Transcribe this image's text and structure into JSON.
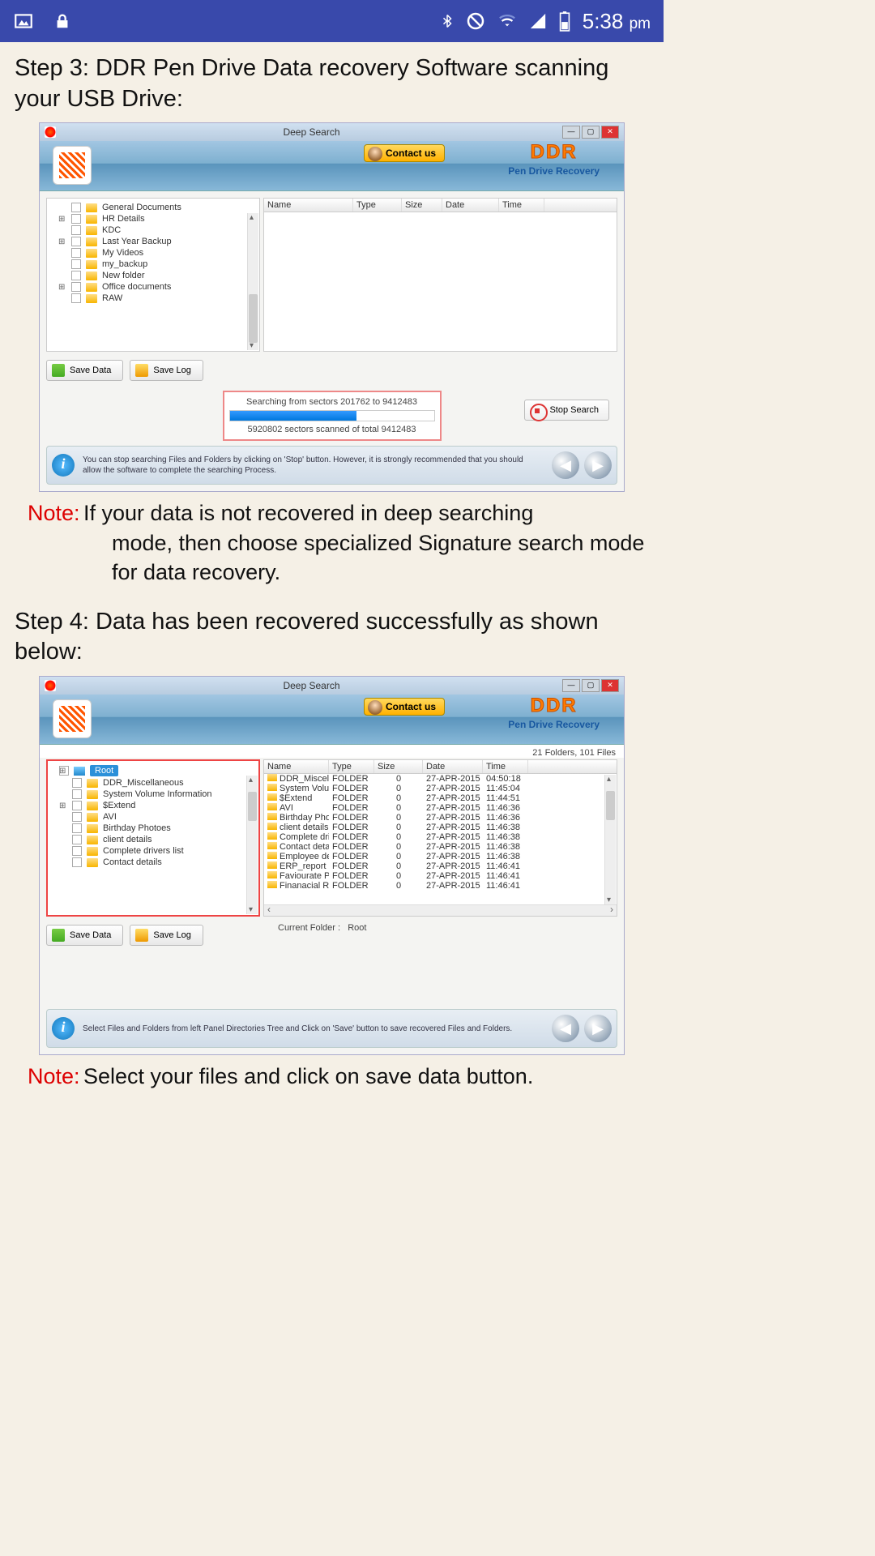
{
  "status": {
    "time": "5:38",
    "ampm": "pm"
  },
  "step3": {
    "title": "Step 3: DDR Pen Drive Data recovery Software scanning your USB Drive:"
  },
  "note1": {
    "label": "Note:",
    "text": "If your data is not recovered in deep searching mode, then choose specialized Signature search mode for data recovery."
  },
  "step4": {
    "title": "Step 4: Data has been recovered successfully as shown below:"
  },
  "note2": {
    "label": "Note:",
    "text": "Select your files and click on save data button."
  },
  "app1": {
    "title": "Deep Search",
    "contact": "Contact us",
    "brand": "DDR",
    "subbrand": "Pen Drive Recovery",
    "tree": [
      "General Documents",
      "HR Details",
      "KDC",
      "Last Year Backup",
      "My Videos",
      "my_backup",
      "New folder",
      "Office documents",
      "RAW"
    ],
    "cols": {
      "name": "Name",
      "type": "Type",
      "size": "Size",
      "date": "Date",
      "time": "Time"
    },
    "save_data": "Save Data",
    "save_log": "Save Log",
    "search_line1": "Searching from sectors  201762 to 9412483",
    "search_line2": "5920802  sectors scanned of total 9412483",
    "stop": "Stop Search",
    "info": "You can stop searching Files and Folders by clicking on 'Stop' button. However, it is strongly recommended that you should allow the software to complete the searching Process."
  },
  "app2": {
    "title": "Deep Search",
    "contact": "Contact us",
    "brand": "DDR",
    "subbrand": "Pen Drive Recovery",
    "count": "21 Folders,  101 Files",
    "root": "Root",
    "tree": [
      "DDR_Miscellaneous",
      "System Volume Information",
      "$Extend",
      "AVI",
      "Birthday Photoes",
      "client details",
      "Complete drivers list",
      "Contact details"
    ],
    "cols": {
      "name": "Name",
      "type": "Type",
      "size": "Size",
      "date": "Date",
      "time": "Time"
    },
    "rows": [
      {
        "n": "DDR_Miscella...",
        "t": "FOLDER",
        "s": "0",
        "d": "27-APR-2015",
        "tm": "04:50:18"
      },
      {
        "n": "System Volu...",
        "t": "FOLDER",
        "s": "0",
        "d": "27-APR-2015",
        "tm": "11:45:04"
      },
      {
        "n": "$Extend",
        "t": "FOLDER",
        "s": "0",
        "d": "27-APR-2015",
        "tm": "11:44:51"
      },
      {
        "n": "AVI",
        "t": "FOLDER",
        "s": "0",
        "d": "27-APR-2015",
        "tm": "11:46:36"
      },
      {
        "n": "Birthday Phot...",
        "t": "FOLDER",
        "s": "0",
        "d": "27-APR-2015",
        "tm": "11:46:36"
      },
      {
        "n": "client details",
        "t": "FOLDER",
        "s": "0",
        "d": "27-APR-2015",
        "tm": "11:46:38"
      },
      {
        "n": "Complete dri...",
        "t": "FOLDER",
        "s": "0",
        "d": "27-APR-2015",
        "tm": "11:46:38"
      },
      {
        "n": "Contact details",
        "t": "FOLDER",
        "s": "0",
        "d": "27-APR-2015",
        "tm": "11:46:38"
      },
      {
        "n": "Employee det...",
        "t": "FOLDER",
        "s": "0",
        "d": "27-APR-2015",
        "tm": "11:46:38"
      },
      {
        "n": "ERP_report",
        "t": "FOLDER",
        "s": "0",
        "d": "27-APR-2015",
        "tm": "11:46:41"
      },
      {
        "n": "Faviourate Pi...",
        "t": "FOLDER",
        "s": "0",
        "d": "27-APR-2015",
        "tm": "11:46:41"
      },
      {
        "n": "Finanacial Re...",
        "t": "FOLDER",
        "s": "0",
        "d": "27-APR-2015",
        "tm": "11:46:41"
      }
    ],
    "cur_folder_lbl": "Current Folder :",
    "cur_folder_val": "Root",
    "save_data": "Save Data",
    "save_log": "Save Log",
    "info": "Select Files and Folders from left Panel Directories Tree and Click on 'Save' button to save recovered Files and Folders."
  }
}
